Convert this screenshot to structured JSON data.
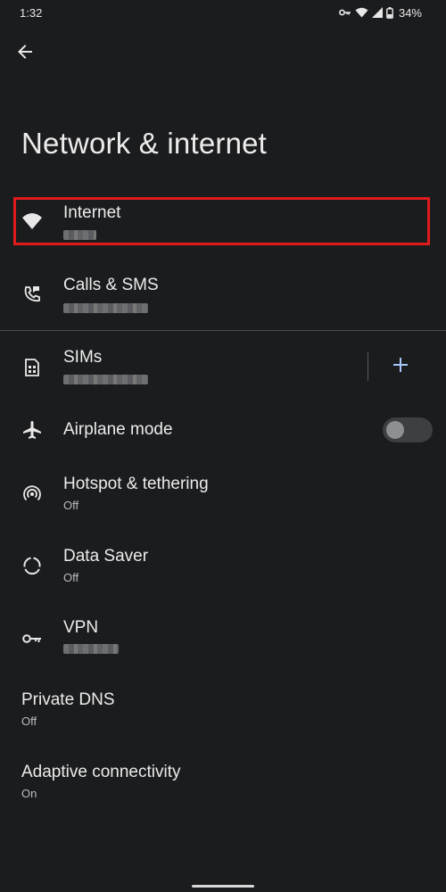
{
  "status_bar": {
    "time": "1:32",
    "battery": "34%"
  },
  "header": {
    "title": "Network & internet"
  },
  "items": [
    {
      "title": "Internet",
      "subtitle": "",
      "icon": "wifi-icon"
    },
    {
      "title": "Calls & SMS",
      "subtitle": "",
      "icon": "calls-sms-icon"
    },
    {
      "title": "SIMs",
      "subtitle": "",
      "icon": "sim-card-icon"
    },
    {
      "title": "Airplane mode",
      "subtitle": "",
      "icon": "airplane-icon",
      "toggle_on": false
    },
    {
      "title": "Hotspot & tethering",
      "subtitle": "Off",
      "icon": "hotspot-icon"
    },
    {
      "title": "Data Saver",
      "subtitle": "Off",
      "icon": "data-saver-icon"
    },
    {
      "title": "VPN",
      "subtitle": "",
      "icon": "vpn-key-icon"
    },
    {
      "title": "Private DNS",
      "subtitle": "Off"
    },
    {
      "title": "Adaptive connectivity",
      "subtitle": "On"
    }
  ],
  "colors": {
    "background": "#1b1c1e",
    "highlight": "#e01b1b",
    "accent": "#a8c7fa"
  }
}
